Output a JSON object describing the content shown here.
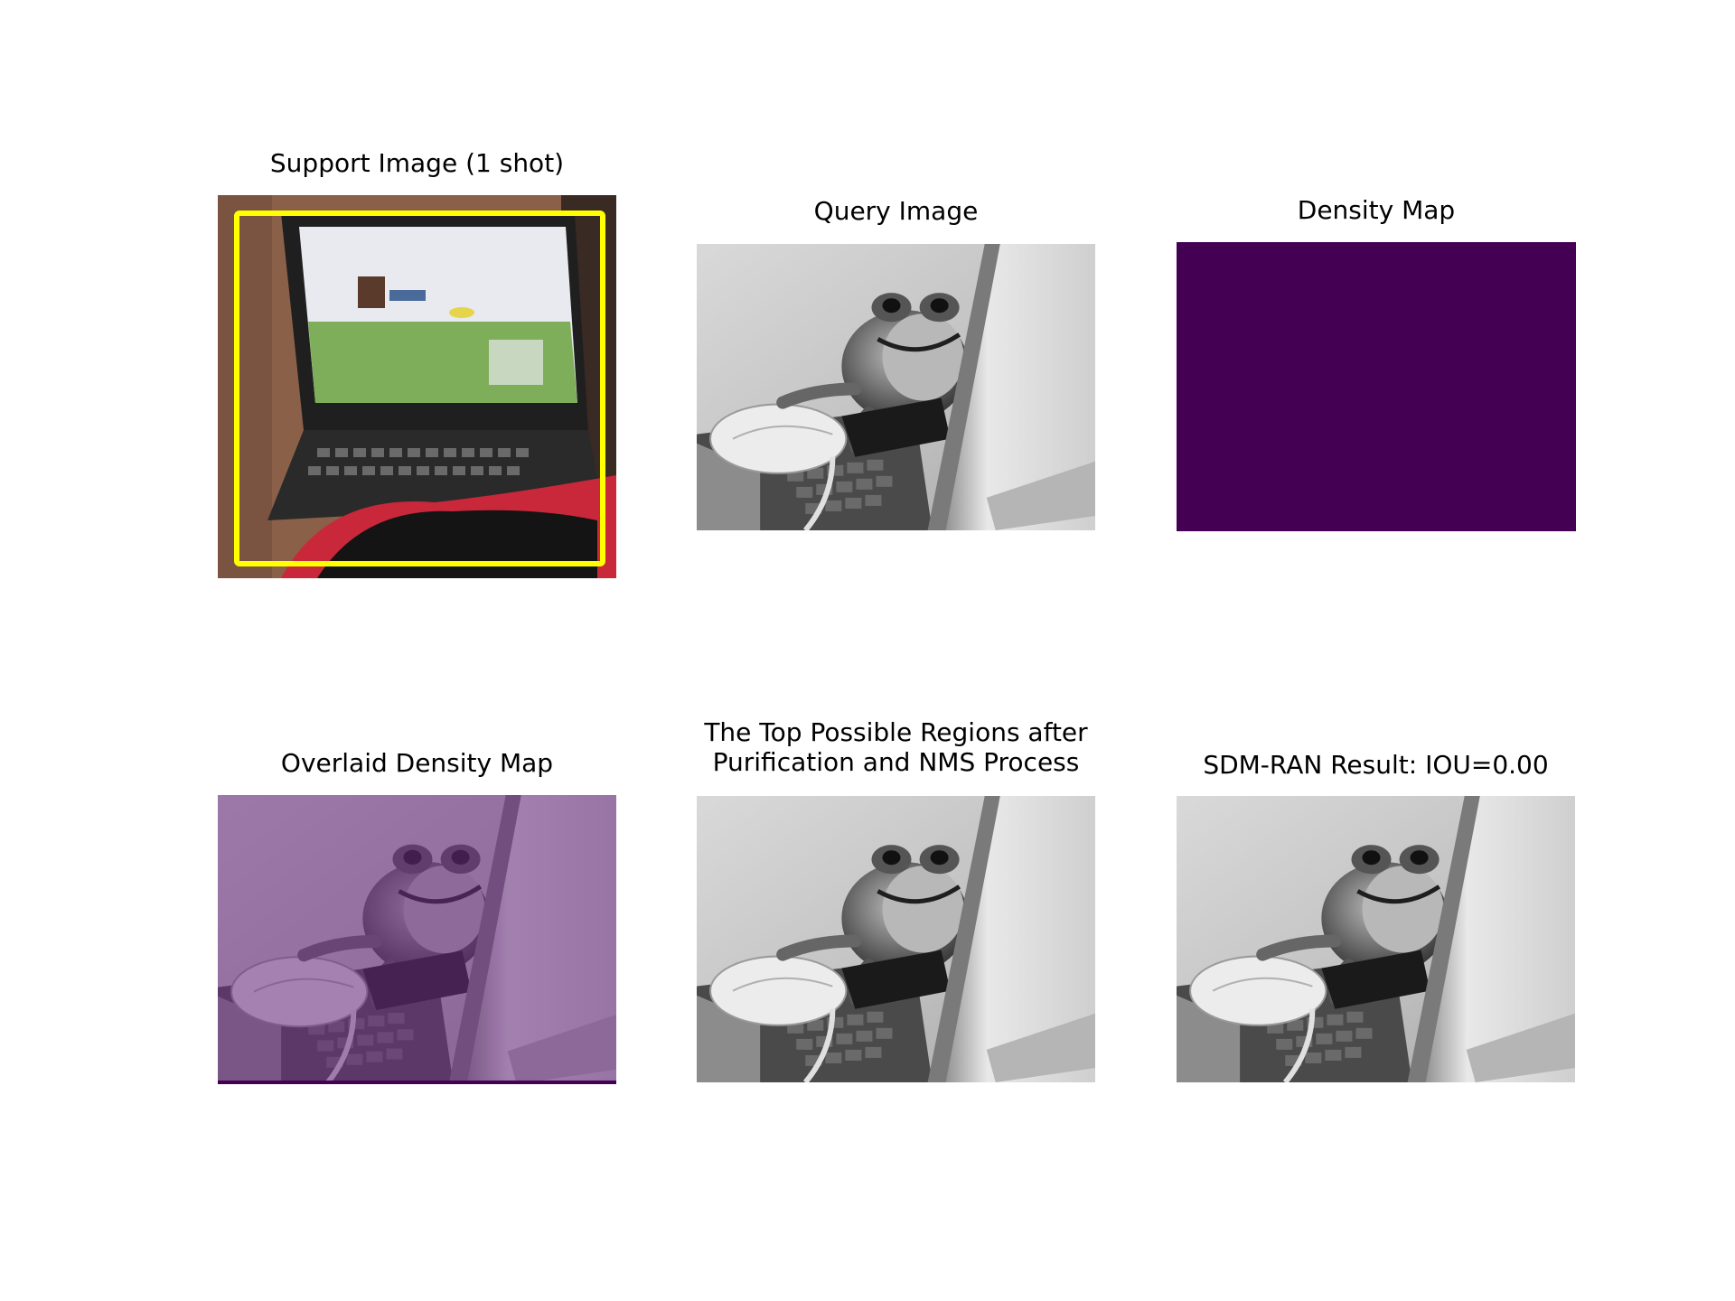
{
  "figure": {
    "panels": [
      {
        "title": "Support Image (1 shot)",
        "content": "laptop-photo-with-yellow-box"
      },
      {
        "title": "Query Image",
        "content": "grayscale-frog-on-laptop"
      },
      {
        "title": "Density Map",
        "content": "uniform-dark-purple"
      },
      {
        "title": "Overlaid Density Map",
        "content": "purple-tinted-frog-on-laptop"
      },
      {
        "title_lines": [
          "The Top Possible Regions after",
          "Purification and NMS Process"
        ],
        "content": "grayscale-frog-on-laptop"
      },
      {
        "title": "SDM-RAN Result: IOU=0.00",
        "content": "grayscale-frog-on-laptop"
      }
    ],
    "colors": {
      "bounding_box": "#ffff00",
      "density_map": "#440154",
      "overlay_tint": "#8b4f9c"
    }
  }
}
